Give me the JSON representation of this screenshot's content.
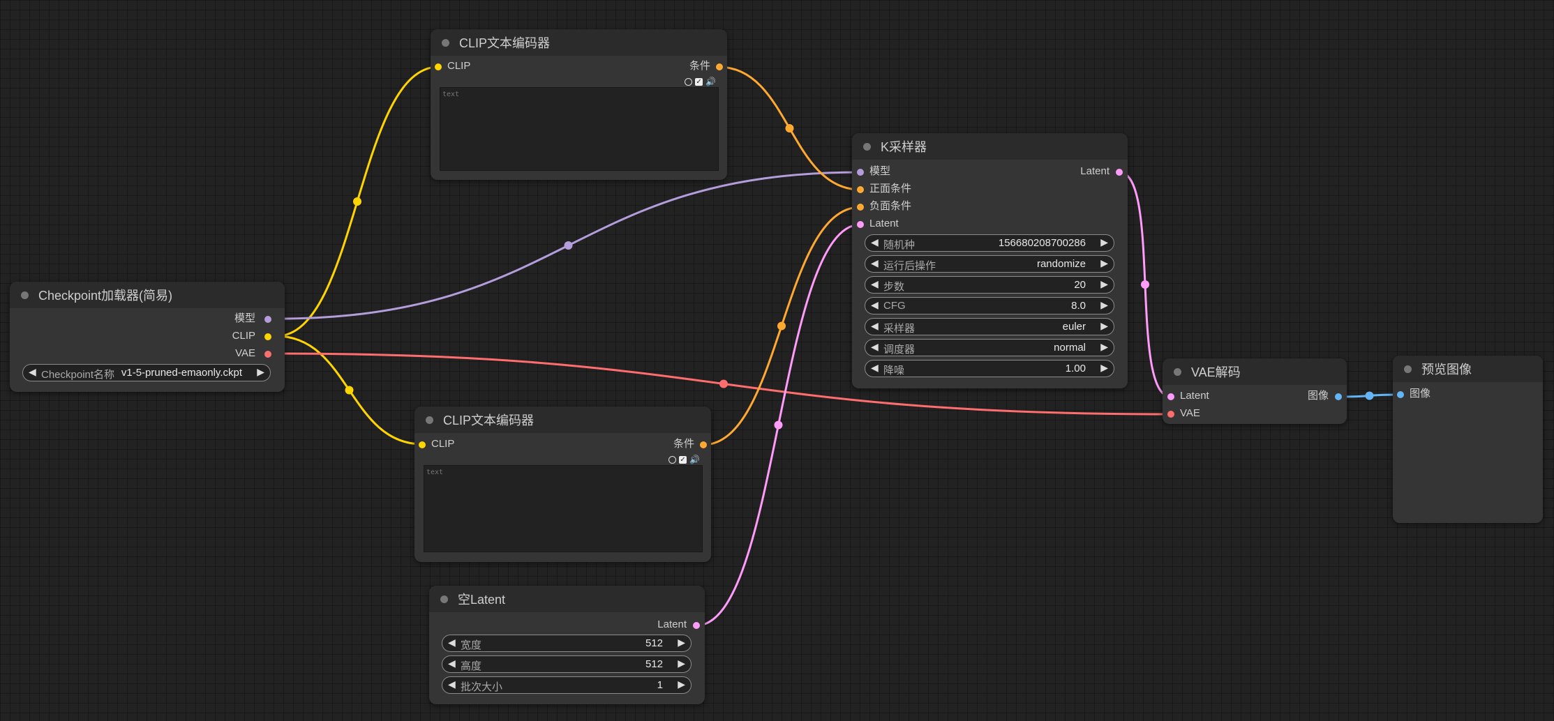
{
  "colors": {
    "model": "#b39ddb",
    "clip": "#ffd500",
    "vae": "#ff6e6e",
    "conditioning": "#ffa931",
    "latent": "#ff9cf9",
    "image": "#64b5f6"
  },
  "checkpoint_loader": {
    "title": "Checkpoint加载器(简易)",
    "outputs": [
      "模型",
      "CLIP",
      "VAE"
    ],
    "widget_label": "Checkpoint名称",
    "widget_value": "v1-5-pruned-emaonly.ckpt"
  },
  "clip_encoder_top": {
    "title": "CLIP文本编码器",
    "input": "CLIP",
    "output": "条件",
    "placeholder": "text"
  },
  "clip_encoder_bottom": {
    "title": "CLIP文本编码器",
    "input": "CLIP",
    "output": "条件",
    "placeholder": "text"
  },
  "ksampler": {
    "title": "K采样器",
    "inputs": [
      "模型",
      "正面条件",
      "负面条件",
      "Latent"
    ],
    "output": "Latent",
    "widgets": [
      {
        "label": "随机种",
        "value": "156680208700286"
      },
      {
        "label": "运行后操作",
        "value": "randomize"
      },
      {
        "label": "步数",
        "value": "20"
      },
      {
        "label": "CFG",
        "value": "8.0"
      },
      {
        "label": "采样器",
        "value": "euler"
      },
      {
        "label": "调度器",
        "value": "normal"
      },
      {
        "label": "降噪",
        "value": "1.00"
      }
    ]
  },
  "empty_latent": {
    "title": "空Latent",
    "output": "Latent",
    "widgets": [
      {
        "label": "宽度",
        "value": "512"
      },
      {
        "label": "高度",
        "value": "512"
      },
      {
        "label": "批次大小",
        "value": "1"
      }
    ]
  },
  "vae_decode": {
    "title": "VAE解码",
    "inputs": [
      "Latent",
      "VAE"
    ],
    "output": "图像"
  },
  "preview_image": {
    "title": "预览图像",
    "input": "图像"
  }
}
